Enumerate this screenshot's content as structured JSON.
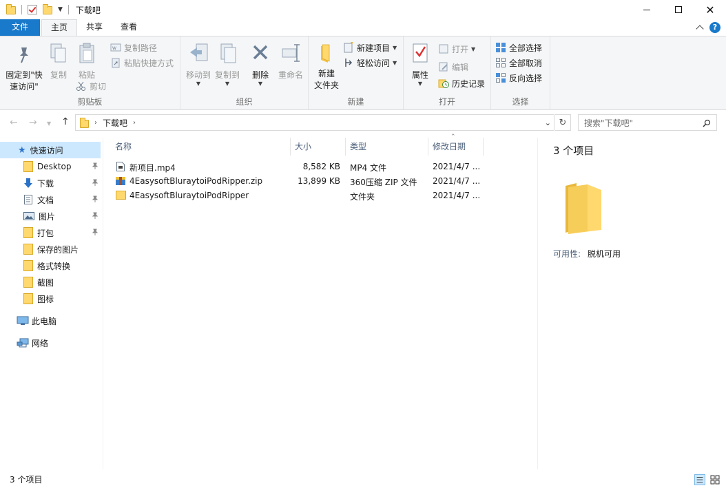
{
  "window": {
    "title": "下载吧"
  },
  "tabs": {
    "file": "文件",
    "home": "主页",
    "share": "共享",
    "view": "查看"
  },
  "ribbon": {
    "clipboard": {
      "pin_line1": "固定到\"快",
      "pin_line2": "速访问\"",
      "copy": "复制",
      "paste": "粘贴",
      "copy_path": "复制路径",
      "paste_shortcut": "粘贴快捷方式",
      "cut": "剪切",
      "label": "剪贴板"
    },
    "organize": {
      "move_to": "移动到",
      "copy_to": "复制到",
      "delete": "删除",
      "rename": "重命名",
      "label": "组织"
    },
    "new": {
      "new_folder_line1": "新建",
      "new_folder_line2": "文件夹",
      "new_item": "新建项目",
      "easy_access": "轻松访问",
      "label": "新建"
    },
    "open": {
      "properties": "属性",
      "open": "打开",
      "edit": "编辑",
      "history": "历史记录",
      "label": "打开"
    },
    "select": {
      "select_all": "全部选择",
      "select_none": "全部取消",
      "invert": "反向选择",
      "label": "选择"
    }
  },
  "address": {
    "current": "下载吧",
    "search_placeholder": "搜索\"下载吧\""
  },
  "nav": {
    "items": [
      {
        "label": "快速访问",
        "icon": "star-icon"
      },
      {
        "label": "Desktop",
        "icon": "folder-icon",
        "pinned": true
      },
      {
        "label": "下载",
        "icon": "download-icon",
        "pinned": true
      },
      {
        "label": "文档",
        "icon": "document-icon",
        "pinned": true
      },
      {
        "label": "图片",
        "icon": "picture-icon",
        "pinned": true
      },
      {
        "label": "打包",
        "icon": "folder-icon",
        "pinned": true
      },
      {
        "label": "保存的图片",
        "icon": "folder-icon"
      },
      {
        "label": "格式转换",
        "icon": "folder-icon"
      },
      {
        "label": "截图",
        "icon": "folder-icon"
      },
      {
        "label": "图标",
        "icon": "folder-icon"
      },
      {
        "label": "此电脑",
        "icon": "computer-icon"
      },
      {
        "label": "网络",
        "icon": "network-icon"
      }
    ]
  },
  "files": {
    "columns": {
      "name": "名称",
      "size": "大小",
      "type": "类型",
      "modified": "修改日期"
    },
    "rows": [
      {
        "name": "新项目.mp4",
        "size": "8,582 KB",
        "type": "MP4 文件",
        "modified": "2021/4/7 ...",
        "icon": "video-file-icon"
      },
      {
        "name": "4EasysoftBluraytoiPodRipper.zip",
        "size": "13,899 KB",
        "type": "360压缩 ZIP 文件",
        "modified": "2021/4/7 ...",
        "icon": "zip-file-icon"
      },
      {
        "name": "4EasysoftBluraytoiPodRipper",
        "size": "",
        "type": "文件夹",
        "modified": "2021/4/7 ...",
        "icon": "folder-icon"
      }
    ]
  },
  "details": {
    "count": "3 个项目",
    "availability_label": "可用性:",
    "availability_value": "脱机可用"
  },
  "status": {
    "text": "3 个项目"
  },
  "colors": {
    "accent": "#1979ca",
    "folder": "#ffd86e",
    "selected": "#cce8ff"
  }
}
